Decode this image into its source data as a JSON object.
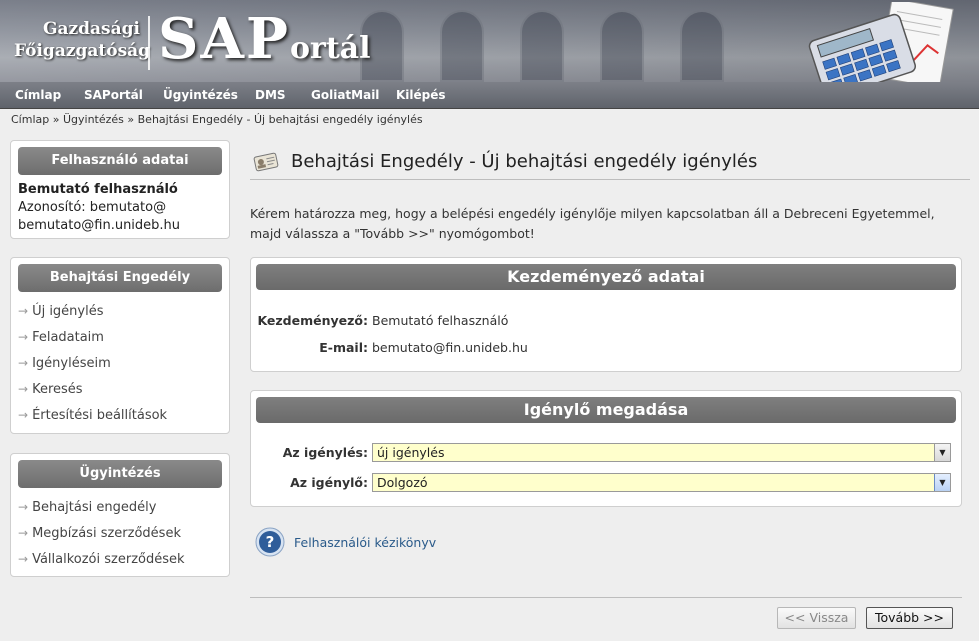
{
  "header": {
    "org_line1": "Gazdasági",
    "org_line2": "Főigazgatóság",
    "logo_sap": "SAP",
    "logo_portal": "ortál"
  },
  "nav": {
    "items": [
      "Címlap",
      "SAPortál",
      "Ügyintézés",
      "DMS",
      "GoliatMail",
      "Kilépés"
    ]
  },
  "breadcrumb": {
    "items": [
      "Címlap",
      "Ügyintézés",
      "Behajtási Engedély - Új behajtási engedély igénylés"
    ],
    "separator": "»"
  },
  "sidebar": {
    "user_box": {
      "title": "Felhasználó adatai",
      "name": "Bemutató felhasználó",
      "id_line": "Azonosító: bemutato@",
      "id_line2": "bemutato@fin.unideb.hu"
    },
    "permit_box": {
      "title": "Behajtási Engedély",
      "items": [
        "Új igénylés",
        "Feladataim",
        "Igényléseim",
        "Keresés",
        "Értesítési beállítások"
      ]
    },
    "admin_box": {
      "title": "Ügyintézés",
      "items": [
        "Behajtási engedély",
        "Megbízási szerződések",
        "Vállalkozói szerződések"
      ]
    }
  },
  "main": {
    "title": "Behajtási Engedély - Új behajtási engedély igénylés",
    "intro_line1": "Kérem határozza meg, hogy a belépési engedély igénylője milyen kapcsolatban áll a Debreceni Egyetemmel,",
    "intro_line2": "majd válassza a \"Tovább >>\" nyomógombot!",
    "initiator": {
      "title": "Kezdeményező adatai",
      "initiator_label": "Kezdeményező:",
      "initiator_value": "Bemutató felhasználó",
      "email_label": "E-mail:",
      "email_value": "bemutato@fin.unideb.hu"
    },
    "applicant": {
      "title": "Igénylő megadása",
      "request_label": "Az igénylés:",
      "request_value": "új igénylés",
      "applicant_label": "Az igénylő:",
      "applicant_value": "Dolgozó"
    },
    "help_link": "Felhasználói kézikönyv",
    "back_button": "<< Vissza",
    "next_button": "Tovább >>"
  },
  "colors": {
    "box_header": "#777777",
    "select_bg": "#ffffcc",
    "link": "#2a5a8a"
  }
}
